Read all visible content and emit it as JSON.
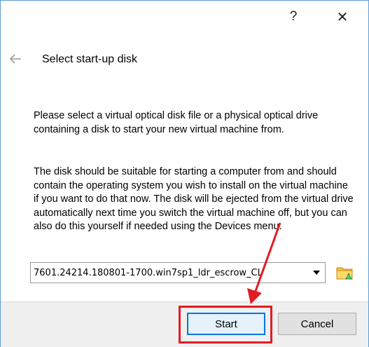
{
  "window": {
    "help_label": "?",
    "close_label": "✕"
  },
  "page": {
    "title": "Select start-up disk",
    "paragraph1": "Please select a virtual optical disk file or a physical optical drive containing a disk to start your new virtual machine from.",
    "paragraph2": "The disk should be suitable for starting a computer from and should contain the operating system you wish to install on the virtual machine if you want to do that now. The disk will be ejected from the virtual drive automatically next time you switch the virtual machine off, but you can also do this yourself if needed using the Devices menu."
  },
  "disk_selector": {
    "value": "7601.24214.180801-1700.win7sp1_ldr_escrow_CL"
  },
  "buttons": {
    "start": "Start",
    "cancel": "Cancel"
  },
  "annotation": {
    "color": "#e31b23"
  },
  "icons": {
    "back": "back-arrow-icon",
    "dropdown": "chevron-down-icon",
    "folder": "folder-icon"
  }
}
